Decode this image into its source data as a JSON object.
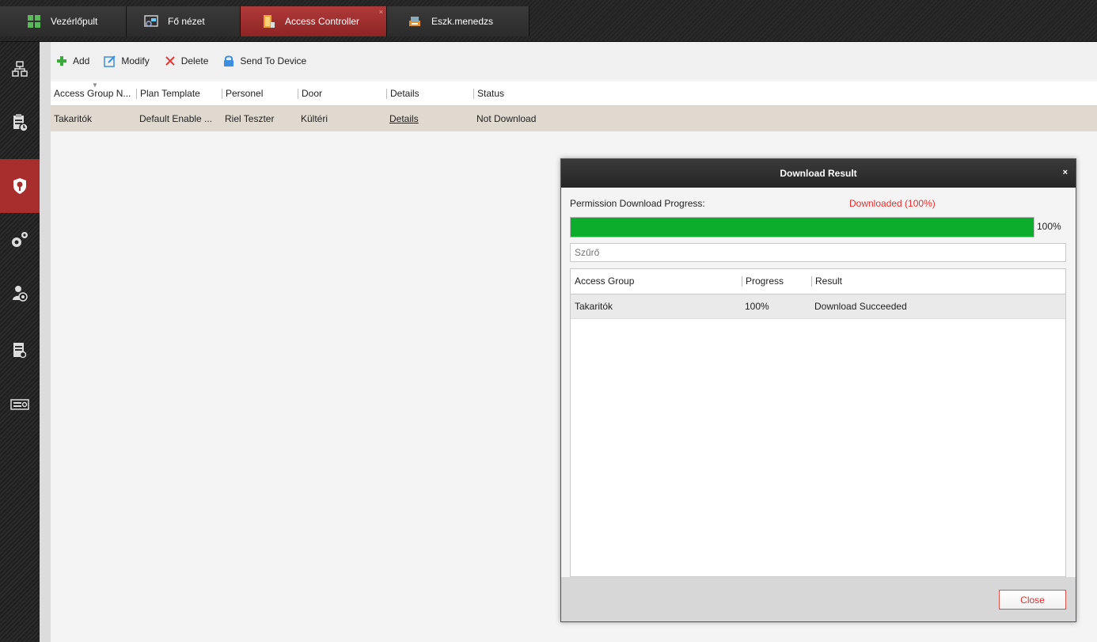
{
  "tabs": [
    {
      "label": "Vezérlőpult",
      "icon": "dashboard-icon"
    },
    {
      "label": "Fő nézet",
      "icon": "main-view-icon"
    },
    {
      "label": "Access Controller",
      "icon": "access-controller-icon",
      "active": true,
      "close": "×"
    },
    {
      "label": "Eszk.menedzs",
      "icon": "device-management-icon"
    }
  ],
  "sidebar": {
    "items": [
      {
        "icon": "organization-icon"
      },
      {
        "icon": "clipboard-clock-icon"
      },
      {
        "icon": "shield-pin-icon",
        "active": true
      },
      {
        "icon": "settings-gears-icon"
      },
      {
        "icon": "person-search-icon"
      },
      {
        "icon": "report-search-icon"
      },
      {
        "icon": "controller-device-icon"
      }
    ]
  },
  "toolbar": {
    "add_label": "Add",
    "modify_label": "Modify",
    "delete_label": "Delete",
    "send_label": "Send To Device"
  },
  "grid": {
    "columns": [
      "Access Group N...",
      "Plan Template",
      "Personel",
      "Door",
      "Details",
      "Status"
    ],
    "rows": [
      {
        "group": "Takaritók",
        "template": "Default Enable ...",
        "personnel": "Riel Teszter",
        "door": "Kültéri",
        "details": "Details",
        "status": "Not Download"
      }
    ]
  },
  "dialog": {
    "title": "Download Result",
    "close_x": "×",
    "progress_label": "Permission Download Progress:",
    "progress_status": "Downloaded (100%)",
    "progress_value": 1.0,
    "progress_pct": "100%",
    "filter_placeholder": "Szűrő",
    "columns": [
      "Access Group",
      "Progress",
      "Result"
    ],
    "rows": [
      {
        "group": "Takaritók",
        "progress": "100%",
        "result": "Download Succeeded"
      }
    ],
    "close_button": "Close"
  },
  "colors": {
    "accent": "#a82d2d",
    "progress": "#0cac2c",
    "status_red": "#e23030"
  }
}
